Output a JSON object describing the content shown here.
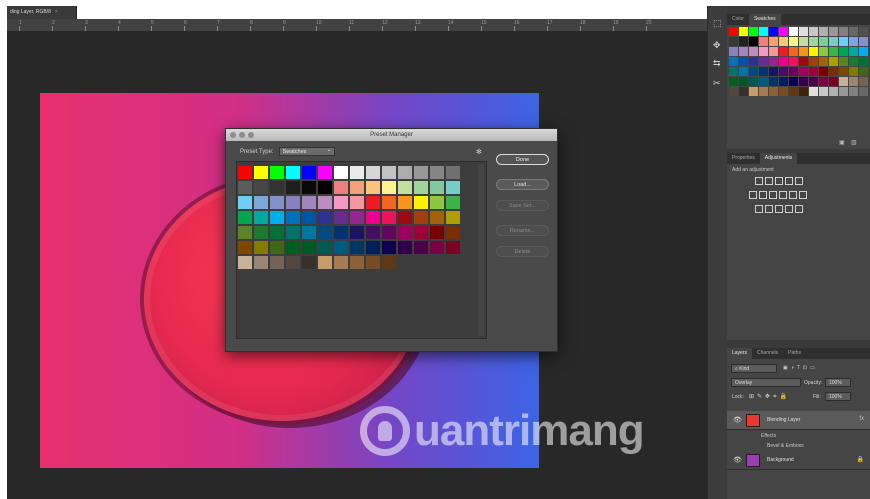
{
  "document": {
    "tab_title": "ding Layer, RGB/8",
    "close_glyph": "×"
  },
  "ruler_ticks": [
    "1",
    "2",
    "3",
    "4",
    "5",
    "6",
    "7",
    "8",
    "9",
    "10",
    "11",
    "12",
    "13",
    "14",
    "15",
    "16",
    "17",
    "18",
    "19",
    "20"
  ],
  "watermark": {
    "text": "uantrimang"
  },
  "dialog": {
    "title": "Preset Manager",
    "preset_type_label": "Preset Type:",
    "preset_type_value": "Swatches",
    "gear_glyph": "✻",
    "buttons": {
      "done": "Done",
      "load": "Load...",
      "save_set": "Save Set...",
      "rename": "Rename...",
      "delete": "Delete"
    },
    "swatches": [
      "#ff0000",
      "#ffff00",
      "#00ff00",
      "#00ffff",
      "#0000ff",
      "#ff00ff",
      "#ffffff",
      "#ebebeb",
      "#d6d6d6",
      "#c2c2c2",
      "#adadad",
      "#999999",
      "#858585",
      "#707070",
      "#5c5c5c",
      "#474747",
      "#333333",
      "#1f1f1f",
      "#0a0a0a",
      "#000000",
      "#ef7f7f",
      "#f5a07a",
      "#fbc47f",
      "#fff390",
      "#c4df9b",
      "#a3d39c",
      "#82ca9d",
      "#7accc8",
      "#6dcff6",
      "#7da7d9",
      "#8393ca",
      "#8781bd",
      "#a186be",
      "#bd8cbf",
      "#f49ac2",
      "#f5989d",
      "#ed1c24",
      "#f26522",
      "#f7941d",
      "#fff200",
      "#8dc63f",
      "#39b54a",
      "#00a651",
      "#00a99d",
      "#00aeef",
      "#0072bc",
      "#0054a6",
      "#2e3192",
      "#662d91",
      "#92278f",
      "#ec008c",
      "#ed145b",
      "#9e0b0f",
      "#a0410d",
      "#a3620a",
      "#aba000",
      "#598527",
      "#1a7b30",
      "#007236",
      "#00746b",
      "#0076a3",
      "#004b80",
      "#003471",
      "#1b1464",
      "#440e62",
      "#630460",
      "#9e005d",
      "#9e0039",
      "#790000",
      "#7b2e00",
      "#7d4900",
      "#827b00",
      "#406618",
      "#005e20",
      "#005826",
      "#005952",
      "#005b7f",
      "#003663",
      "#002157",
      "#0d004c",
      "#32004b",
      "#4b0049",
      "#7b0046",
      "#7a0026",
      "#c7b299",
      "#998675",
      "#736357",
      "#534741",
      "#37302d",
      "#c69c6d",
      "#a67c52",
      "#8c6239",
      "#754c24",
      "#603913"
    ]
  },
  "tools": [
    "⬚",
    "✥",
    "⇆",
    "✂"
  ],
  "swatches_panel": {
    "tabs": [
      "Color",
      "Swatches"
    ],
    "active_tab": "Swatches",
    "colors": [
      "#ff0000",
      "#ffff00",
      "#00ff00",
      "#00ffff",
      "#0000ff",
      "#ff00ff",
      "#ffffff",
      "#e0e0e0",
      "#c8c8c8",
      "#b0b0b0",
      "#989898",
      "#808080",
      "#686868",
      "#505050",
      "#383838",
      "#202020",
      "#000000",
      "#ef7f7f",
      "#f5a07a",
      "#fbc47f",
      "#fff390",
      "#c4df9b",
      "#a3d39c",
      "#82ca9d",
      "#7accc8",
      "#6dcff6",
      "#7da7d9",
      "#8393ca",
      "#8781bd",
      "#a186be",
      "#bd8cbf",
      "#f49ac2",
      "#f5989d",
      "#ed1c24",
      "#f26522",
      "#f7941d",
      "#fff200",
      "#8dc63f",
      "#39b54a",
      "#00a651",
      "#00a99d",
      "#00aeef",
      "#0072bc",
      "#0054a6",
      "#2e3192",
      "#662d91",
      "#92278f",
      "#ec008c",
      "#ed145b",
      "#9e0b0f",
      "#a0410d",
      "#a3620a",
      "#aba000",
      "#598527",
      "#1a7b30",
      "#007236",
      "#00746b",
      "#0076a3",
      "#004b80",
      "#003471",
      "#1b1464",
      "#440e62",
      "#630460",
      "#9e005d",
      "#9e0039",
      "#790000",
      "#7b2e00",
      "#7d4900",
      "#827b00",
      "#406618",
      "#005e20",
      "#005826",
      "#005952",
      "#005b7f",
      "#003663",
      "#002157",
      "#0d004c",
      "#32004b",
      "#4b0049",
      "#7b0046",
      "#7a0026",
      "#c7b299",
      "#998675",
      "#736357",
      "#534741",
      "#37302d",
      "#c69c6d",
      "#a67c52",
      "#8c6239",
      "#754c24",
      "#603913",
      "#42210b",
      "#e0e0e0",
      "#c8c8c8",
      "#b0b0b0",
      "#989898",
      "#808080",
      "#686868"
    ]
  },
  "adjustments_panel": {
    "tabs": [
      "Properties",
      "Adjustments"
    ],
    "active_tab": "Adjustments",
    "label": "Add an adjustment"
  },
  "layers_panel": {
    "tabs": [
      "Layers",
      "Channels",
      "Paths"
    ],
    "active_tab": "Layers",
    "filter_kind": "Kind",
    "blend_mode": "Overlay",
    "opacity_label": "Opacity:",
    "opacity_value": "100%",
    "lock_label": "Lock:",
    "fill_label": "Fill:",
    "fill_value": "100%",
    "layers": [
      {
        "name": "Blending Layer",
        "thumb_color": "#e8382f",
        "fx": "fx"
      },
      {
        "name": "Background",
        "thumb_color": "#9b3fb0",
        "fx": ""
      }
    ],
    "effects_label": "Effects",
    "bevel_label": "Bevel & Emboss",
    "eye_glyph": "👁",
    "lock_glyph": "🔒"
  }
}
